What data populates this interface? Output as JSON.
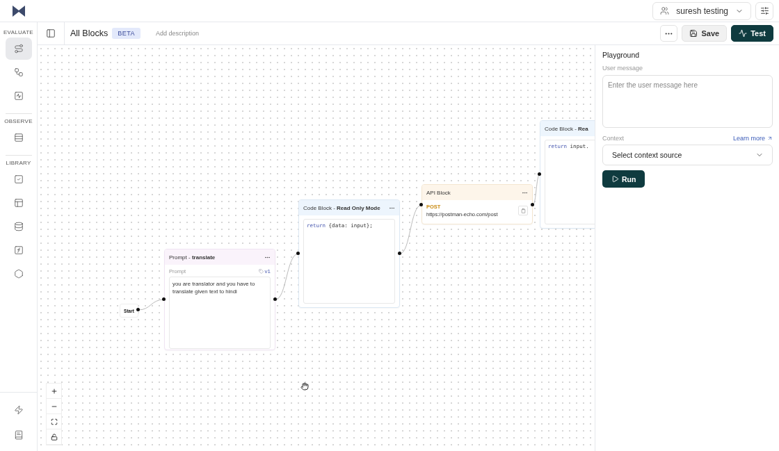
{
  "topbar": {
    "workspace": "suresh testing"
  },
  "sidebar": {
    "sections": [
      {
        "label": "EVALUATE",
        "items": [
          {
            "selected": true
          },
          {
            "selected": false
          },
          {
            "selected": false
          }
        ]
      },
      {
        "label": "OBSERVE",
        "items": [
          {
            "selected": false
          }
        ]
      },
      {
        "label": "LIBRARY",
        "items": [
          {
            "selected": false
          },
          {
            "selected": false
          },
          {
            "selected": false
          },
          {
            "selected": false
          },
          {
            "selected": false
          }
        ]
      }
    ],
    "bottom_items": [
      {
        "selected": false
      },
      {
        "selected": false
      }
    ]
  },
  "header": {
    "title": "All Blocks",
    "badge": "BETA",
    "description_placeholder": "Add description",
    "buttons": [
      {
        "kind": "more"
      },
      {
        "kind": "save",
        "label": "Save"
      },
      {
        "kind": "test",
        "label": "Test"
      }
    ]
  },
  "canvas": {
    "start": {
      "label": "Start"
    },
    "nodes": [
      {
        "kind": "prompt",
        "title": "Prompt - **translate**",
        "field_label": "Prompt",
        "version": "v1",
        "text": "you are translator and you have to translate given text to hindi"
      },
      {
        "kind": "code",
        "title": "Code Block - **Read Only Mode**",
        "code_keyword": "return",
        "code_rest": "{data: input};"
      },
      {
        "kind": "api",
        "title": "API Block",
        "method": "POST",
        "url": "https://postman-echo.com/post"
      },
      {
        "kind": "code",
        "title": "Code Block - **Rea**",
        "code_keyword": "return",
        "code_rest": "input."
      }
    ],
    "controls": [
      {
        "kind": "zoom-in"
      },
      {
        "kind": "zoom-out"
      },
      {
        "kind": "fit"
      },
      {
        "kind": "lock"
      }
    ]
  },
  "playground": {
    "title": "Playground",
    "message_label": "User message",
    "message_placeholder": "Enter the user message here",
    "context_label": "Context",
    "learn_more": "Learn more",
    "context_select": "Select context source",
    "run": "Run"
  }
}
